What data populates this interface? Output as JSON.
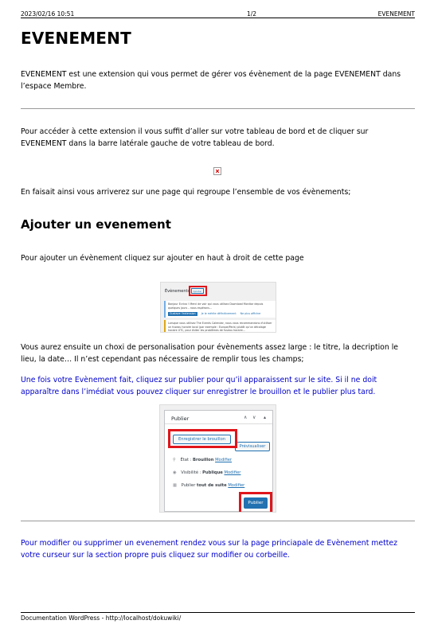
{
  "header": {
    "datetime": "2023/02/16 10:51",
    "page": "1/2",
    "doc_title": "EVENEMENT"
  },
  "title": "EVENEMENT",
  "intro": "EVENEMENT est une extension qui vous permet de gérer vos évènement de la page EVENEMENT dans l’espace Membre.",
  "access_text": "Pour accéder à cette extension il vous suffit d’aller sur votre tableau de bord et de cliquer sur EVENEMENT dans la barre latérale gauche de votre tableau de bord.",
  "arrive_text": "En faisait ainsi vous arriverez sur une page qui regroupe l’ensemble de vos évènements;",
  "section": {
    "title": "Ajouter un evenement",
    "add_text": "Pour ajouter un évènement cliquez sur ajouter en haut à droit de cette page",
    "choice_text": "Vous aurez ensuite un choxi de personalisation pour évènements assez large : le titre, la decription le lieu, la date… Il n’est cependant pas nécessaire de remplir tous les champs;",
    "publish_text": "Une fois votre Evènement fait, cliquez sur publier pour qu’il apparaissent sur le site. Si il ne doit apparaître dans l’imédiat vous pouvez cliquer sur enregistrer le brouillon et le publier plus tard."
  },
  "modify_text": "Pour modifier ou supprimer un evenement rendez vous sur la page princiapale de Evènement mettez votre curseur sur la section propre puis cliquez sur modifier ou corbeille.",
  "screenshot1": {
    "title": "Évènements",
    "add_button": "Ajouter",
    "notice1_text": "Bonjour Ecrivo ! Merci de voir qui vous utilisez Download Monitor depuis quelques jours – nous espérons...",
    "notice1_button": "Gustave l'extension",
    "notice1_link1": "Je le mérite définitivement",
    "notice1_link2": "Ne plus afficher",
    "notice2_text": "Lorsque vous utilisez The Events Calendar, nous vous recommandons d'utiliser un fuseau horaire local (par exemple : Europe/Paris) plutôt qu'un décalage horaire UTC, pour éviter les problèmes de fuseau horaire..."
  },
  "screenshot2": {
    "box_title": "Publier",
    "draft_button": "Enregistrer le brouillon",
    "preview_button": "Prévisualiser",
    "status_label": "État :",
    "status_value": "Brouillon",
    "visibility_label": "Visibilité :",
    "visibility_value": "Publique",
    "schedule_label": "Publier",
    "schedule_value": "tout de suite",
    "modify_link": "Modifier",
    "publish_button": "Publier"
  },
  "footer": "Documentation WordPress - http://localhost/dokuwiki/",
  "colors": {
    "link_blue": "#0000cc",
    "highlight_red": "#e0151b",
    "wp_blue": "#2271b1"
  }
}
